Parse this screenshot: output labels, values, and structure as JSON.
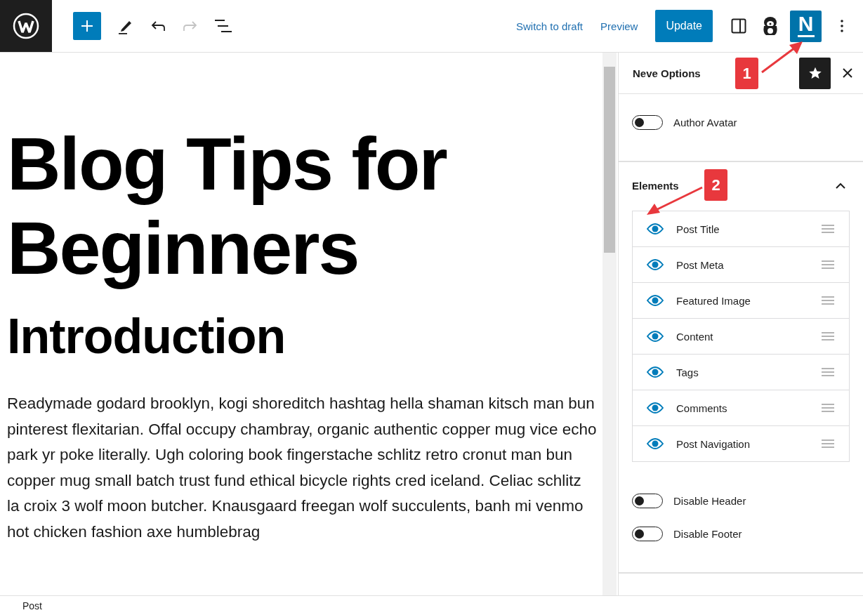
{
  "toolbar": {
    "redo_disabled": true,
    "links": [
      "Switch to draft",
      "Preview"
    ],
    "update_label": "Update",
    "settings_open": true,
    "neve_logo": "N",
    "neve_active": true
  },
  "post": {
    "title": "Blog Tips for Beginners",
    "heading": "Introduction",
    "paragraph": "Readymade godard brooklyn, kogi shoreditch hashtag hella shaman kitsch man bun pinterest flexitarian. Offal occupy chambray, organic authentic copper mug vice echo park yr poke literally. Ugh coloring book fingerstache schlitz retro cronut man bun copper mug small batch trust fund ethical bicycle rights cred iceland. Celiac schlitz la croix 3 wolf moon butcher. Knausgaard freegan wolf succulents, banh mi venmo hot chicken fashion axe humblebrag"
  },
  "sidebar": {
    "title": "Neve Options",
    "top_toggles": [
      {
        "label": "Author Avatar",
        "on": false
      }
    ],
    "elements": {
      "title": "Elements",
      "expanded": true,
      "items": [
        {
          "label": "Post Title",
          "visible": true
        },
        {
          "label": "Post Meta",
          "visible": true
        },
        {
          "label": "Featured Image",
          "visible": true
        },
        {
          "label": "Content",
          "visible": true
        },
        {
          "label": "Tags",
          "visible": true
        },
        {
          "label": "Comments",
          "visible": true
        },
        {
          "label": "Post Navigation",
          "visible": true
        }
      ]
    },
    "bottom_toggles": [
      {
        "label": "Disable Header",
        "on": false
      },
      {
        "label": "Disable Footer",
        "on": false
      }
    ]
  },
  "annotations": [
    {
      "label": "1"
    },
    {
      "label": "2"
    }
  ],
  "status_bar": {
    "breadcrumb": "Post"
  }
}
